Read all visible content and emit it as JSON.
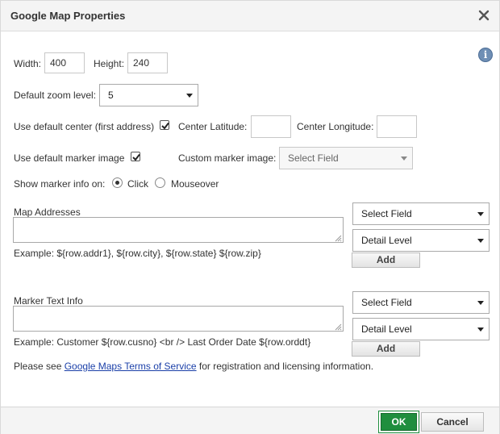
{
  "dialog": {
    "title": "Google Map Properties",
    "close_icon": "close-icon",
    "help_icon": "info-icon",
    "help_glyph": "i"
  },
  "size": {
    "width_label": "Width:",
    "width_value": "400",
    "height_label": "Height:",
    "height_value": "240"
  },
  "zoom": {
    "label": "Default zoom level:",
    "value": "5"
  },
  "center": {
    "use_default_label": "Use default center (first address)",
    "use_default_checked": true,
    "latitude_label": "Center Latitude:",
    "latitude_value": "",
    "longitude_label": "Center Longitude:",
    "longitude_value": ""
  },
  "marker": {
    "use_default_label": "Use default marker image",
    "use_default_checked": true,
    "custom_label": "Custom marker image:",
    "custom_value": "Select Field"
  },
  "marker_info": {
    "label": "Show marker info on:",
    "options": [
      "Click",
      "Mouseover"
    ],
    "selected": "Click"
  },
  "addresses": {
    "label": "Map Addresses",
    "value": "",
    "field_select": "Select Field",
    "detail_select": "Detail Level",
    "add_label": "Add",
    "example": "Example: ${row.addr1}, ${row.city}, ${row.state} ${row.zip}"
  },
  "marker_text": {
    "label": "Marker Text Info",
    "value": "",
    "field_select": "Select Field",
    "detail_select": "Detail Level",
    "add_label": "Add",
    "example": "Example: Customer ${row.cusno} <br /> Last Order Date ${row.orddt}"
  },
  "terms": {
    "prefix": "Please see ",
    "link": "Google Maps Terms of Service",
    "suffix": " for registration and licensing information."
  },
  "footer": {
    "ok_label": "OK",
    "cancel_label": "Cancel"
  },
  "colors": {
    "ok_button": "#1f8e3e",
    "link": "#1a3fa8",
    "titlebar": "#f4f4f4"
  }
}
